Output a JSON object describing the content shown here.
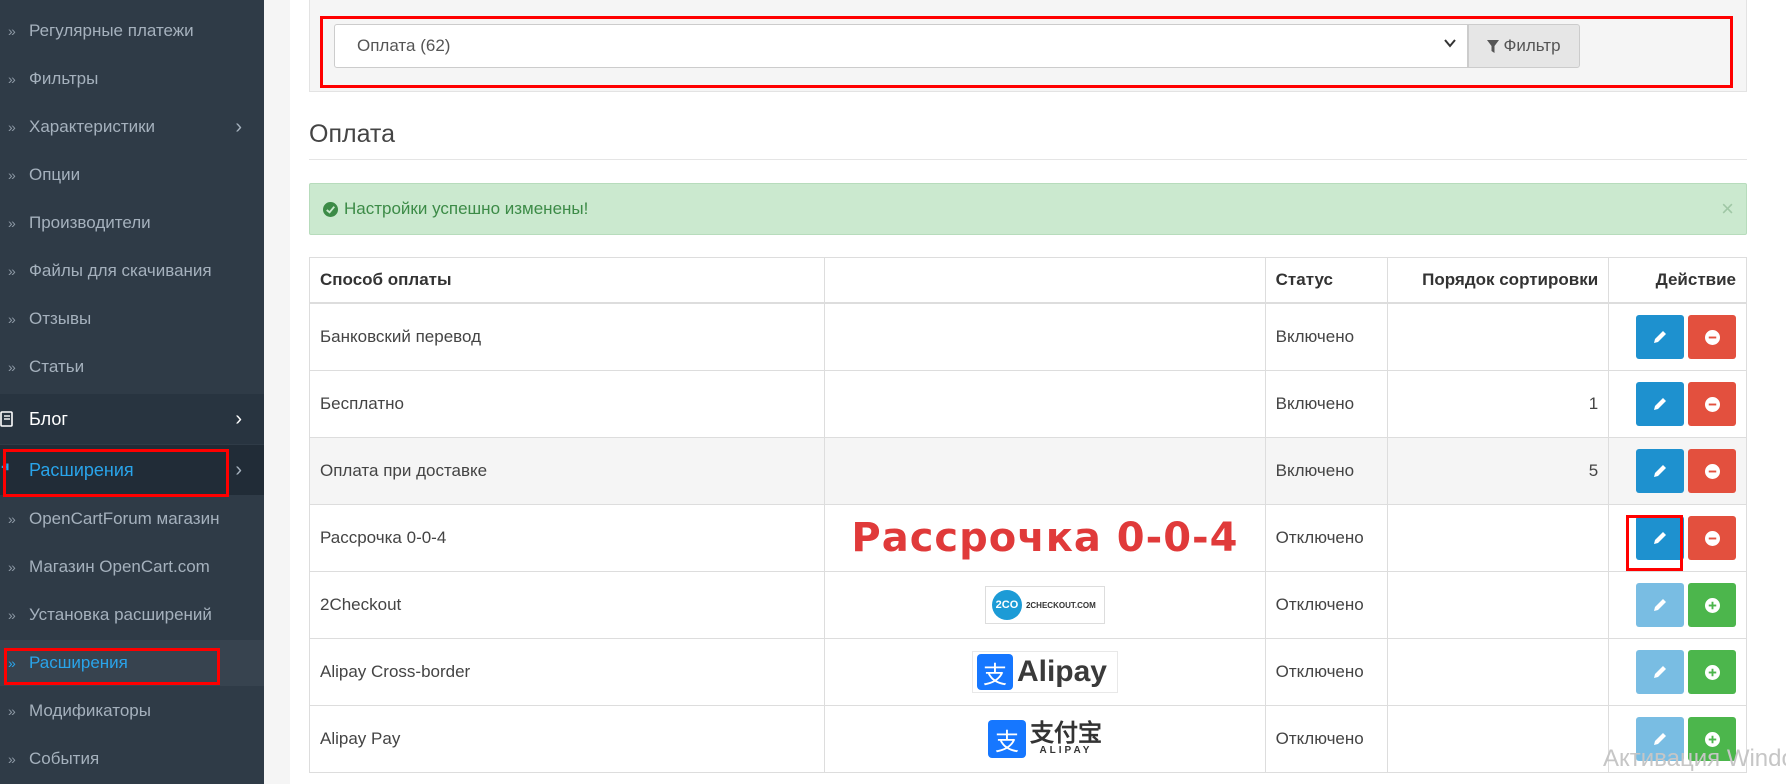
{
  "sidebar": {
    "items": [
      {
        "label": "Регулярные платежи"
      },
      {
        "label": "Фильтры"
      },
      {
        "label": "Характеристики"
      },
      {
        "label": "Опции"
      },
      {
        "label": "Производители"
      },
      {
        "label": "Файлы для скачивания"
      },
      {
        "label": "Отзывы"
      },
      {
        "label": "Статьи"
      }
    ],
    "blog": {
      "label": "Блог"
    },
    "extensions": {
      "label": "Расширения"
    },
    "sub_items": [
      {
        "label": "OpenCartForum магазин"
      },
      {
        "label": "Магазин OpenCart.com"
      },
      {
        "label": "Установка расширений"
      },
      {
        "label": "Расширения"
      },
      {
        "label": "Модификаторы"
      },
      {
        "label": "События"
      }
    ]
  },
  "filter": {
    "selected": "Оплата (62)",
    "button_label": "Фильтр"
  },
  "page": {
    "title": "Оплата"
  },
  "alert": {
    "text": "Настройки успешно изменены!",
    "close": "×"
  },
  "table": {
    "headers": {
      "name": "Способ оплаты",
      "logo": "",
      "status": "Статус",
      "sort": "Порядок сортировки",
      "action": "Действие"
    },
    "rows": [
      {
        "name": "Банковский перевод",
        "status": "Включено",
        "sort": "",
        "installed": true
      },
      {
        "name": "Бесплатно",
        "status": "Включено",
        "sort": "1",
        "installed": true
      },
      {
        "name": "Оплата при доставке",
        "status": "Включено",
        "sort": "5",
        "installed": true
      },
      {
        "name": "Рассрочка 0-0-4",
        "status": "Отключено",
        "sort": "",
        "installed": true,
        "logo_text": "Рассрочка 0-0-4"
      },
      {
        "name": "2Checkout",
        "status": "Отключено",
        "sort": "",
        "installed": false,
        "logo_text": "2CO",
        "logo_sub": "2CHECKOUT.COM"
      },
      {
        "name": "Alipay Cross-border",
        "status": "Отключено",
        "sort": "",
        "installed": false,
        "logo_text": "Alipay"
      },
      {
        "name": "Alipay Pay",
        "status": "Отключено",
        "sort": "",
        "installed": false,
        "logo_text": "支付宝",
        "logo_sub": "ALIPAY"
      }
    ]
  },
  "watermark": "Активация Windows",
  "colors": {
    "sidebar_bg": "#2f3b47",
    "accent": "#1e91cf",
    "danger": "#e3503e",
    "success": "#4cb64c",
    "highlight": "#ff0000"
  }
}
